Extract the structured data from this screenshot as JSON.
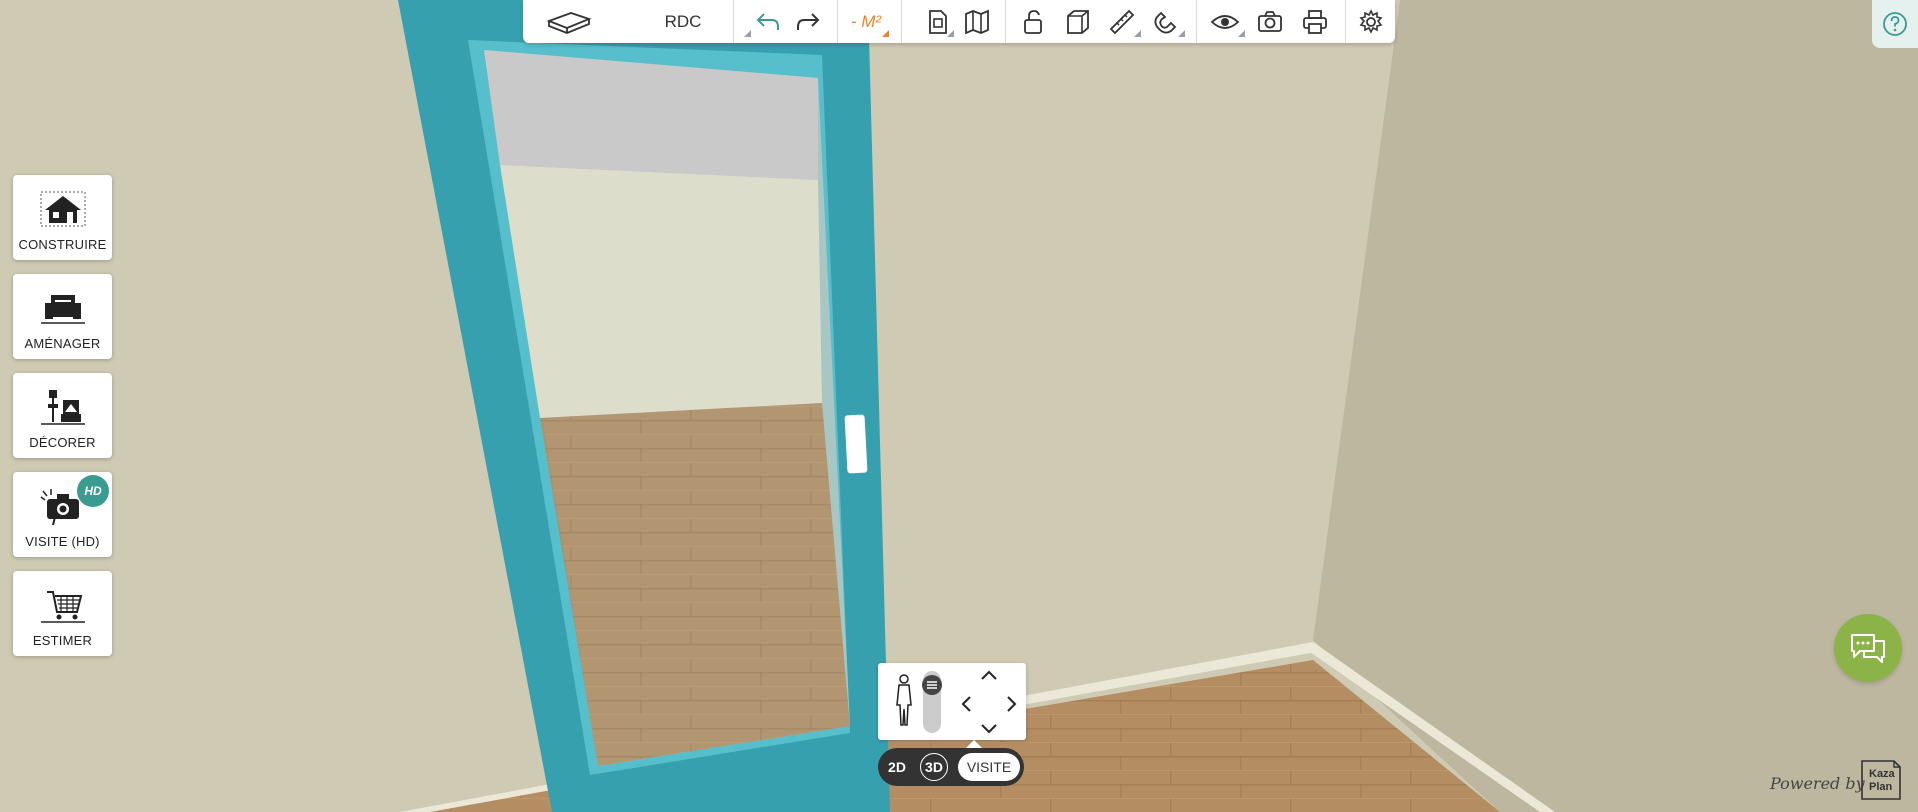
{
  "toolbar": {
    "floor_label": "RDC",
    "area_label": "- M²",
    "buttons": [
      {
        "name": "floor-plan-icon"
      },
      {
        "name": "undo-icon"
      },
      {
        "name": "redo-icon"
      },
      {
        "name": "document-icon"
      },
      {
        "name": "map-icon"
      },
      {
        "name": "unlock-icon"
      },
      {
        "name": "cube-icon"
      },
      {
        "name": "ruler-icon"
      },
      {
        "name": "magnet-icon"
      },
      {
        "name": "eye-icon"
      },
      {
        "name": "camera-icon"
      },
      {
        "name": "printer-icon"
      },
      {
        "name": "gear-icon"
      }
    ]
  },
  "help": {
    "icon": "question-circle-icon"
  },
  "sidebar": {
    "items": [
      {
        "label": "CONSTRUIRE",
        "icon": "house-icon"
      },
      {
        "label": "AMÉNAGER",
        "icon": "sofa-icon"
      },
      {
        "label": "DÉCORER",
        "icon": "lamp-frame-icon"
      },
      {
        "label": "VISITE (HD)",
        "icon": "camera-hd-icon",
        "badge": "HD"
      },
      {
        "label": "ESTIMER",
        "icon": "cart-icon"
      }
    ]
  },
  "navigation": {
    "modes": [
      "2D",
      "3D",
      "VISITE"
    ],
    "active_mode": "VISITE"
  },
  "chat": {
    "icon": "chat-bubbles-icon"
  },
  "footer": {
    "powered_by": "Powered by",
    "logo_text": [
      "Kaza",
      "Plan"
    ]
  },
  "colors": {
    "accent": "#3a9b8f",
    "door_frame": "#36a0ad",
    "wall": "#cfcab1",
    "floor": "#b08a60",
    "chat": "#8cb347",
    "area_orange": "#e8842b"
  }
}
